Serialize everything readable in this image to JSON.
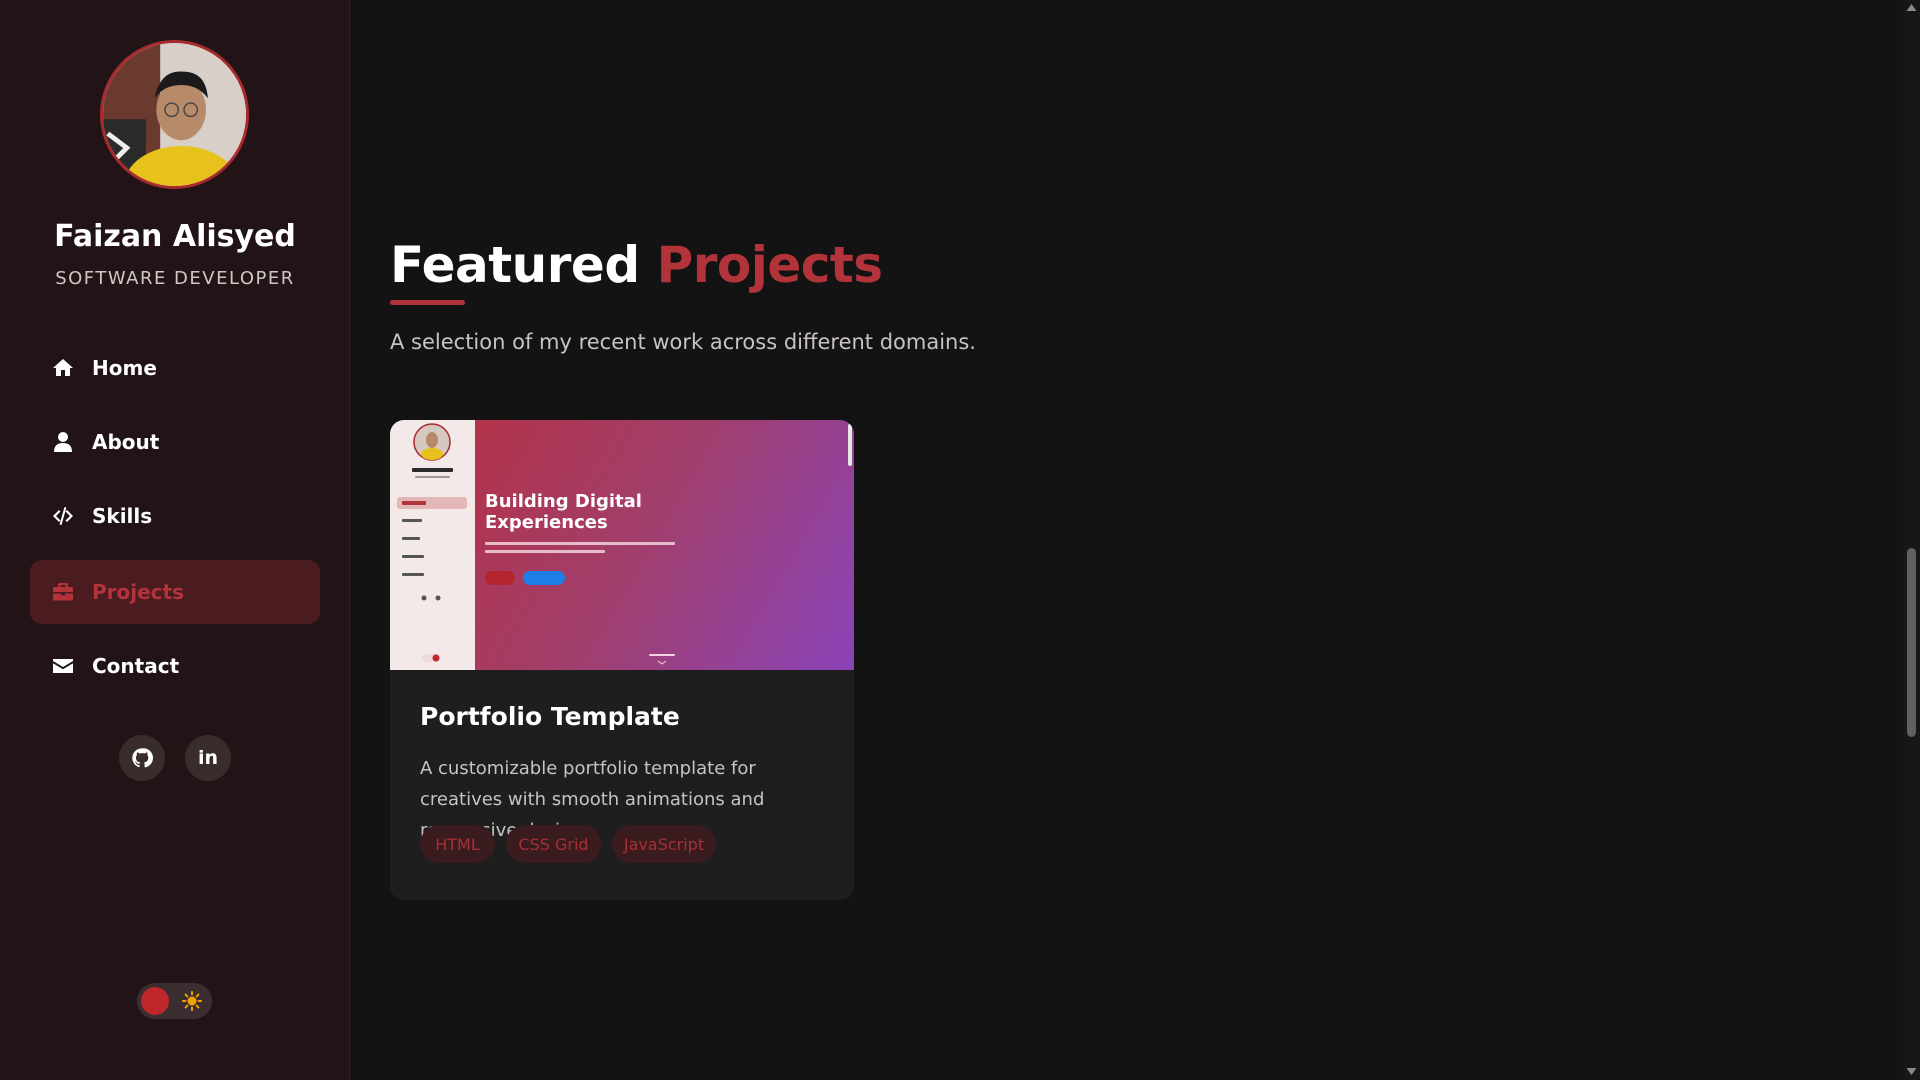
{
  "profile": {
    "name": "Faizan Alisyed",
    "role": "SOFTWARE DEVELOPER"
  },
  "nav": {
    "items": [
      {
        "label": "Home",
        "icon": "home-icon"
      },
      {
        "label": "About",
        "icon": "user-icon"
      },
      {
        "label": "Skills",
        "icon": "code-icon"
      },
      {
        "label": "Projects",
        "icon": "briefcase-icon",
        "active": true
      },
      {
        "label": "Contact",
        "icon": "envelope-icon"
      }
    ]
  },
  "socials": [
    {
      "name": "github",
      "icon": "github-icon"
    },
    {
      "name": "linkedin",
      "icon": "linkedin-icon",
      "glyph": "in"
    }
  ],
  "theme_toggle": {
    "icon": "sun-icon"
  },
  "section": {
    "title_main": "Featured",
    "title_accent": "Projects",
    "subtitle": "A selection of my recent work across different domains."
  },
  "projects": [
    {
      "title": "Portfolio Template",
      "description": "A customizable portfolio template for creatives with smooth animations and responsive design.",
      "preview_heading": "Building Digital Experiences",
      "tags": [
        "HTML",
        "CSS Grid",
        "JavaScript"
      ]
    }
  ],
  "colors": {
    "accent": "#b3333a",
    "sidebar_bg": "#221416",
    "page_bg": "#141314",
    "card_bg": "#1f1e1f",
    "tag_bg": "#3a1b1e"
  }
}
